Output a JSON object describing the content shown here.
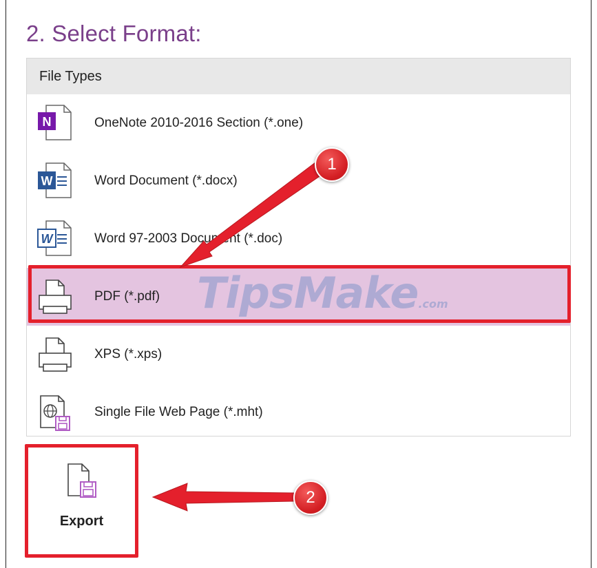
{
  "title": "2. Select Format:",
  "file_types": {
    "header": "File Types",
    "items": [
      {
        "label": "OneNote 2010-2016 Section (*.one)",
        "icon": "onenote-icon"
      },
      {
        "label": "Word Document (*.docx)",
        "icon": "word-docx-icon"
      },
      {
        "label": "Word 97-2003 Document (*.doc)",
        "icon": "word-doc-icon"
      },
      {
        "label": "PDF (*.pdf)",
        "icon": "pdf-printer-icon",
        "selected": true
      },
      {
        "label": "XPS (*.xps)",
        "icon": "xps-printer-icon"
      },
      {
        "label": "Single File Web Page (*.mht)",
        "icon": "web-page-icon"
      }
    ]
  },
  "export": {
    "label": "Export",
    "icon": "export-icon"
  },
  "annotations": {
    "step1": "1",
    "step2": "2",
    "arrow_color": "#e4202c"
  },
  "watermark": {
    "brand": "TipsMake",
    "suffix": ".com"
  },
  "colors": {
    "title": "#7a3f8a",
    "selected_row": "#e4c4e0",
    "header_bg": "#e8e8e8",
    "onenote": "#7719aa",
    "word": "#2b5797",
    "export_accent": "#b05cc4"
  }
}
